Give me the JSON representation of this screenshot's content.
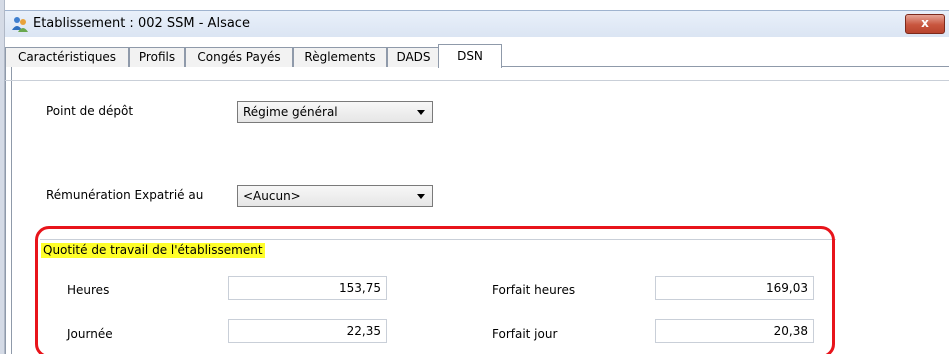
{
  "window": {
    "title": "Etablissement : 002 SSM - Alsace",
    "close_label": "x"
  },
  "tabs": [
    {
      "label": "Caractéristiques",
      "active": false
    },
    {
      "label": "Profils",
      "active": false
    },
    {
      "label": "Congés Payés",
      "active": false
    },
    {
      "label": "Règlements",
      "active": false
    },
    {
      "label": "DADS",
      "active": false
    },
    {
      "label": "DSN",
      "active": true
    }
  ],
  "form": {
    "point_depot_label": "Point de dépôt",
    "point_depot_value": "Régime général",
    "remuneration_label": "Rémunération Expatrié au",
    "remuneration_value": "<Aucun>"
  },
  "quotite": {
    "title": "Quotité de travail de l'établissement",
    "heures_label": "Heures",
    "heures_value": "153,75",
    "journee_label": "Journée",
    "journee_value": "22,35",
    "forfait_heures_label": "Forfait heures",
    "forfait_heures_value": "169,03",
    "forfait_jour_label": "Forfait jour",
    "forfait_jour_value": "20,38"
  },
  "colors": {
    "highlight_outline": "#e8141b",
    "title_highlight": "#ffff2a"
  }
}
